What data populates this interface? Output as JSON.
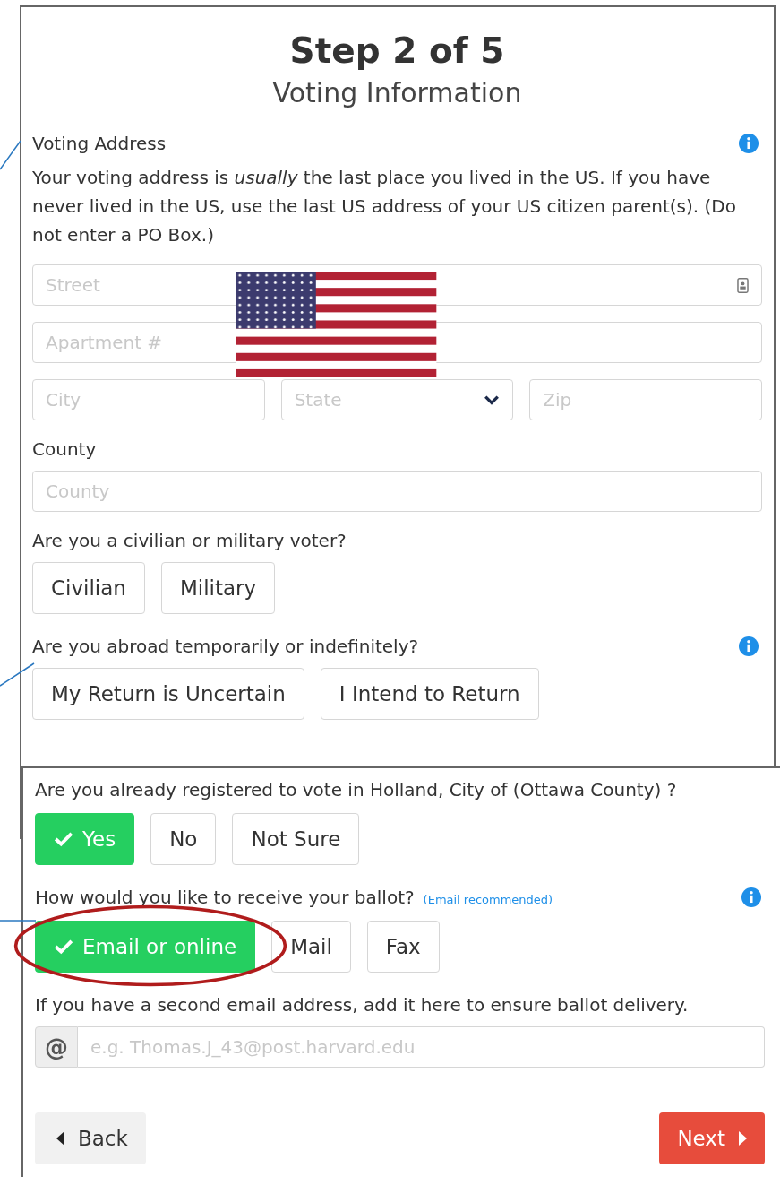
{
  "panel_1": {
    "step": "Step 2 of 5",
    "title": "Voting Information",
    "address": {
      "label": "Voting Address",
      "info": true,
      "description": "Your voting address is *usually* the last place you lived in the US. If you have never lived in the US, use the last US address of your US citizen parent(s). (Do not enter a PO Box.)",
      "field_rows": [
        [
          {
            "kind": "contact",
            "placeholder": "Street"
          }
        ],
        [
          {
            "kind": "text",
            "placeholder": "Apartment #"
          }
        ],
        [
          {
            "kind": "text",
            "placeholder": "City"
          },
          {
            "kind": "select",
            "placeholder": "State"
          },
          {
            "kind": "text",
            "placeholder": "Zip"
          }
        ]
      ]
    },
    "county": {
      "label": "County",
      "placeholder": "County"
    },
    "questions": [
      {
        "text": "Are you a civilian or military voter?",
        "info": false,
        "options": [
          {
            "label": "Civilian",
            "selected": false
          },
          {
            "label": "Military",
            "selected": false
          }
        ]
      },
      {
        "text": "Are you abroad temporarily or indefinitely?",
        "info": true,
        "options": [
          {
            "label": "My Return is Uncertain",
            "selected": false
          },
          {
            "label": "I Intend to Return",
            "selected": false
          }
        ]
      }
    ]
  },
  "panel_2": {
    "questions": [
      {
        "text": "Are you already registered to vote in Holland, City of (Ottawa County) ?",
        "info": false,
        "options": [
          {
            "label": "Yes",
            "selected": true
          },
          {
            "label": "No",
            "selected": false
          },
          {
            "label": "Not Sure",
            "selected": false
          }
        ]
      },
      {
        "text": "How would you like to receive your ballot?",
        "note": "(Email recommended)",
        "info": true,
        "options": [
          {
            "label": "Email or online",
            "selected": true
          },
          {
            "label": "Mail",
            "selected": false
          },
          {
            "label": "Fax",
            "selected": false
          }
        ]
      }
    ],
    "second_email": {
      "label": "If you have a second email address, add it here to ensure ballot delivery.",
      "addon": "@",
      "placeholder": "e.g. Thomas.J_43@post.harvard.edu"
    },
    "back": "Back",
    "next": "Next"
  }
}
